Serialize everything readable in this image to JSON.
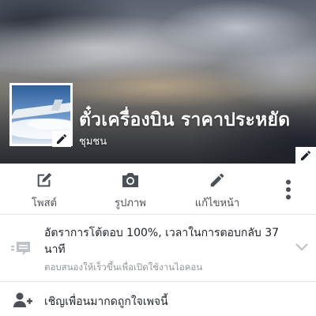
{
  "header": {
    "page_name": "ตั๋วเครื่องบิน ราคาประหยัด",
    "category": "ชุมชน"
  },
  "actions": [
    {
      "label": "โพสต์",
      "icon": "compose-icon"
    },
    {
      "label": "รูปภาพ",
      "icon": "camera-icon"
    },
    {
      "label": "แก้ไขหน้า",
      "icon": "pencil-icon"
    },
    {
      "label": "",
      "icon": "more-vertical-icon"
    }
  ],
  "response": {
    "title": "อัตราการโต้ตอบ 100%, เวลาในการตอบกลับ 37 นาที",
    "subtitle": "ตอบสนองให้เร็วขึ้นเพื่อเปิดใช้งานไอคอน",
    "icon": "chat-bubble-icon"
  },
  "invite": {
    "label": "เชิญเพื่อนมากดถูกใจเพจนี้",
    "icon": "add-person-icon"
  },
  "colors": {
    "text_primary": "#1d2129",
    "text_secondary": "#90949c",
    "icon_gray": "#4b4f56",
    "icon_light": "#bec2c9"
  }
}
